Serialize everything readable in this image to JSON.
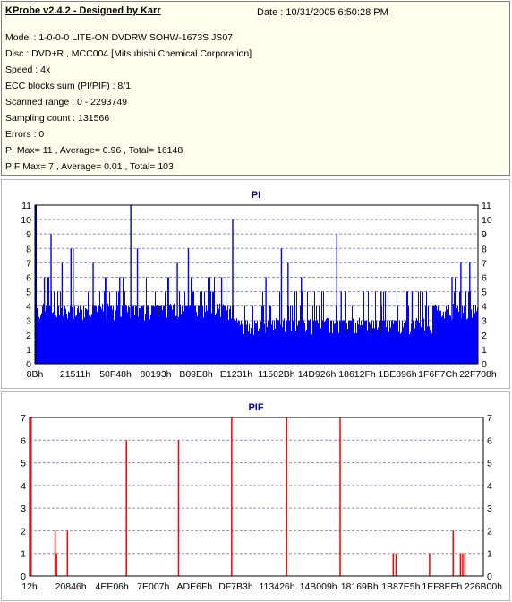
{
  "info": {
    "title": "KProbe v2.4.2 - Designed by Karr",
    "date": "Date : 10/31/2005 6:50:28 PM",
    "lines": [
      "Model : 1-0-0-0 LITE-ON DVDRW SOHW-1673S JS07",
      "Disc : DVD+R , MCC004 [Mitsubishi Chemical Corporation]",
      "Speed : 4x",
      "ECC blocks sum (PI/PIF) : 8/1",
      "Scanned range : 0 - 2293749",
      "Sampling count : 131566",
      "Errors : 0",
      "PI Max= 11 , Average= 0.96 , Total= 16148",
      "PIF Max= 7 , Average= 0.01 , Total= 103"
    ]
  },
  "colors": {
    "pi": "#0000ff",
    "pif": "#ff0000",
    "title": "#000080",
    "grid": "#9090c0"
  },
  "chart_data": [
    {
      "type": "bar",
      "title": "PI",
      "ylim": [
        0,
        11
      ],
      "yticks": [
        0,
        1,
        2,
        3,
        4,
        5,
        6,
        7,
        8,
        9,
        10,
        11
      ],
      "xticks": [
        "8Bh",
        "21511h",
        "50F48h",
        "80193h",
        "B09E8h",
        "E1231h",
        "11502Bh",
        "14D926h",
        "18612Fh",
        "1BE896h",
        "1F6F7Ch",
        "22F708h"
      ],
      "grid": "horizontal dashed",
      "summary": {
        "max": 11,
        "average": 0.96,
        "total": 16148
      },
      "spikes": [
        {
          "pos": 0.0,
          "value": 11
        },
        {
          "pos": 0.02,
          "value": 6
        },
        {
          "pos": 0.028,
          "value": 6
        },
        {
          "pos": 0.035,
          "value": 9
        },
        {
          "pos": 0.06,
          "value": 7
        },
        {
          "pos": 0.08,
          "value": 8
        },
        {
          "pos": 0.085,
          "value": 8
        },
        {
          "pos": 0.13,
          "value": 7
        },
        {
          "pos": 0.16,
          "value": 6
        },
        {
          "pos": 0.19,
          "value": 6
        },
        {
          "pos": 0.215,
          "value": 11
        },
        {
          "pos": 0.23,
          "value": 8
        },
        {
          "pos": 0.3,
          "value": 6
        },
        {
          "pos": 0.32,
          "value": 7
        },
        {
          "pos": 0.345,
          "value": 8
        },
        {
          "pos": 0.42,
          "value": 6
        },
        {
          "pos": 0.445,
          "value": 10
        },
        {
          "pos": 0.52,
          "value": 6
        },
        {
          "pos": 0.555,
          "value": 8
        },
        {
          "pos": 0.57,
          "value": 7
        },
        {
          "pos": 0.6,
          "value": 6
        },
        {
          "pos": 0.68,
          "value": 9
        },
        {
          "pos": 0.69,
          "value": 5
        },
        {
          "pos": 0.78,
          "value": 5
        },
        {
          "pos": 0.85,
          "value": 5
        },
        {
          "pos": 0.94,
          "value": 6
        },
        {
          "pos": 0.96,
          "value": 7
        },
        {
          "pos": 0.98,
          "value": 7
        }
      ],
      "baseline": [
        {
          "from": 0.0,
          "to": 0.2,
          "value": 4
        },
        {
          "from": 0.2,
          "to": 0.45,
          "value": 4
        },
        {
          "from": 0.45,
          "to": 0.7,
          "value": 3
        },
        {
          "from": 0.7,
          "to": 0.9,
          "value": 3
        },
        {
          "from": 0.9,
          "to": 1.0,
          "value": 4
        }
      ]
    },
    {
      "type": "bar",
      "title": "PIF",
      "ylim": [
        0,
        7
      ],
      "yticks": [
        0,
        1,
        2,
        3,
        4,
        5,
        6,
        7
      ],
      "xticks": [
        "12h",
        "20846h",
        "4EE06h",
        "7E007h",
        "ADE6Fh",
        "DF7B3h",
        "113426h",
        "14B009h",
        "18169Bh",
        "1B87E5h",
        "1EF8EEh",
        "226B00h"
      ],
      "grid": "horizontal dashed",
      "summary": {
        "max": 7,
        "average": 0.01,
        "total": 103
      },
      "x": [
        0.001,
        0.055,
        0.058,
        0.082,
        0.212,
        0.327,
        0.444,
        0.565,
        0.683,
        0.8,
        0.806,
        0.88,
        0.932,
        0.948,
        0.953,
        0.958
      ],
      "values": [
        7,
        2,
        1,
        2,
        6,
        6,
        7,
        7,
        7,
        1,
        1,
        1,
        2,
        1,
        1,
        1
      ]
    }
  ]
}
